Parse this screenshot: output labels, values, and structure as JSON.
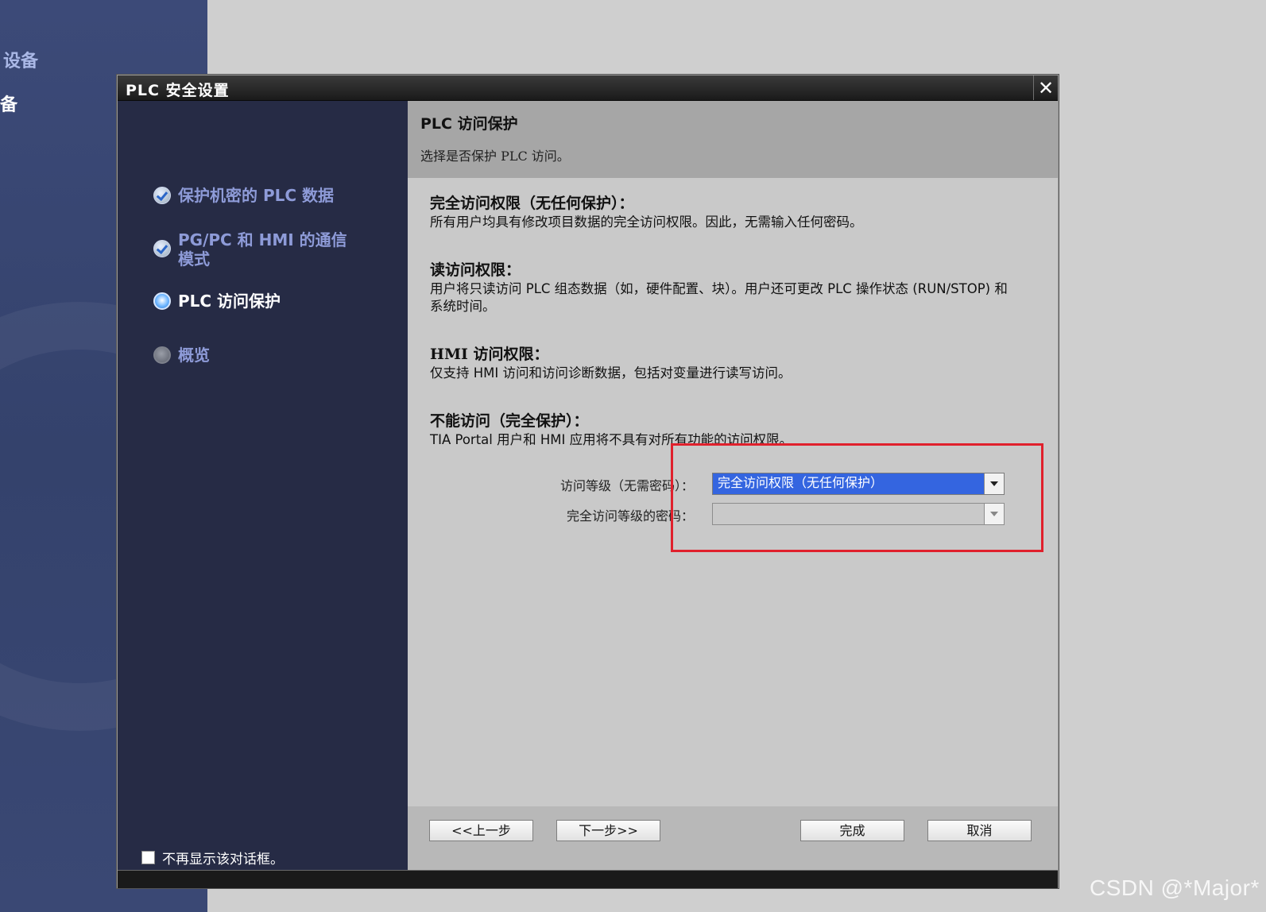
{
  "background": {
    "items": [
      "设备",
      "备"
    ]
  },
  "dialog": {
    "title": "PLC 安全设置",
    "close_symbol": "✕"
  },
  "nav": {
    "items": [
      {
        "label": "保护机密的 PLC 数据",
        "state": "done"
      },
      {
        "label": "PG/PC 和 HMI 的通信模式",
        "state": "done"
      },
      {
        "label": "PLC 访问保护",
        "state": "active"
      },
      {
        "label": "概览",
        "state": "pending"
      }
    ],
    "no_show_label": "不再显示该对话框。"
  },
  "header": {
    "title": "PLC 访问保护",
    "subtitle": "选择是否保护 PLC 访问。"
  },
  "sections": [
    {
      "title": "完全访问权限（无任何保护）：",
      "desc": "所有用户均具有修改项目数据的完全访问权限。因此，无需输入任何密码。"
    },
    {
      "title": "读访问权限：",
      "desc": "用户将只读访问 PLC 组态数据（如，硬件配置、块）。用户还可更改 PLC 操作状态 (RUN/STOP) 和系统时间。"
    },
    {
      "title": "HMI 访问权限：",
      "desc": "仅支持 HMI 访问和访问诊断数据，包括对变量进行读写访问。"
    },
    {
      "title": "不能访问（完全保护）：",
      "desc": "TIA Portal 用户和 HMI 应用将不具有对所有功能的访问权限。"
    }
  ],
  "form": {
    "access_level_label": "访问等级（无需密码）：",
    "access_level_value": "完全访问权限（无任何保护）",
    "password_label": "完全访问等级的密码：",
    "password_value": ""
  },
  "buttons": {
    "prev": "<<上一步",
    "next": "下一步>>",
    "finish": "完成",
    "cancel": "取消"
  },
  "watermark": "CSDN @*Major*",
  "colors": {
    "highlight": "#e0202c",
    "selected": "#3465e0",
    "nav_bg": "#262b45"
  }
}
